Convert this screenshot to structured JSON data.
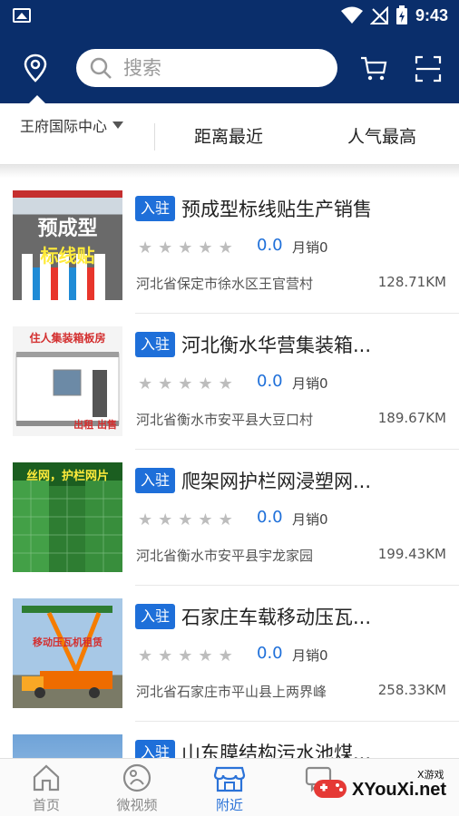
{
  "status": {
    "time": "9:43"
  },
  "search": {
    "placeholder": "搜索"
  },
  "filter": {
    "region": "王府国际中心",
    "options": [
      "距离最近",
      "人气最高"
    ]
  },
  "listings": [
    {
      "badge": "入驻",
      "title": "预成型标线贴生产销售",
      "rating": "0.0",
      "sales": "月销0",
      "address": "河北省保定市徐水区王官营村",
      "distance": "128.71KM",
      "thumb_caption": [
        "预成型",
        "标线贴"
      ]
    },
    {
      "badge": "入驻",
      "title": "河北衡水华营集装箱...",
      "rating": "0.0",
      "sales": "月销0",
      "address": "河北省衡水市安平县大豆口村",
      "distance": "189.67KM",
      "thumb_caption": [
        "住人集装箱板房",
        "出租 出售"
      ]
    },
    {
      "badge": "入驻",
      "title": "爬架网护栏网浸塑网...",
      "rating": "0.0",
      "sales": "月销0",
      "address": "河北省衡水市安平县宇龙家园",
      "distance": "199.43KM",
      "thumb_caption": [
        "丝网，护栏网片"
      ]
    },
    {
      "badge": "入驻",
      "title": "石家庄车载移动压瓦...",
      "rating": "0.0",
      "sales": "月销0",
      "address": "河北省石家庄市平山县上两界峰",
      "distance": "258.33KM",
      "thumb_caption": [
        "移动压瓦机租赁"
      ]
    },
    {
      "badge": "入驻",
      "title": "山东膜结构污水池煤..."
    }
  ],
  "nav": {
    "tabs": [
      {
        "label": "首页",
        "icon": "home-icon"
      },
      {
        "label": "微视频",
        "icon": "video-icon"
      },
      {
        "label": "附近",
        "icon": "shop-icon",
        "active": true
      },
      {
        "label": "",
        "icon": "message-icon"
      }
    ]
  },
  "watermark": {
    "brand": "XYouXi.net",
    "small": "X游戏"
  },
  "colors": {
    "header": "#0a2e6b",
    "accent": "#1e6fd9",
    "active_tab": "#2a72d8"
  }
}
